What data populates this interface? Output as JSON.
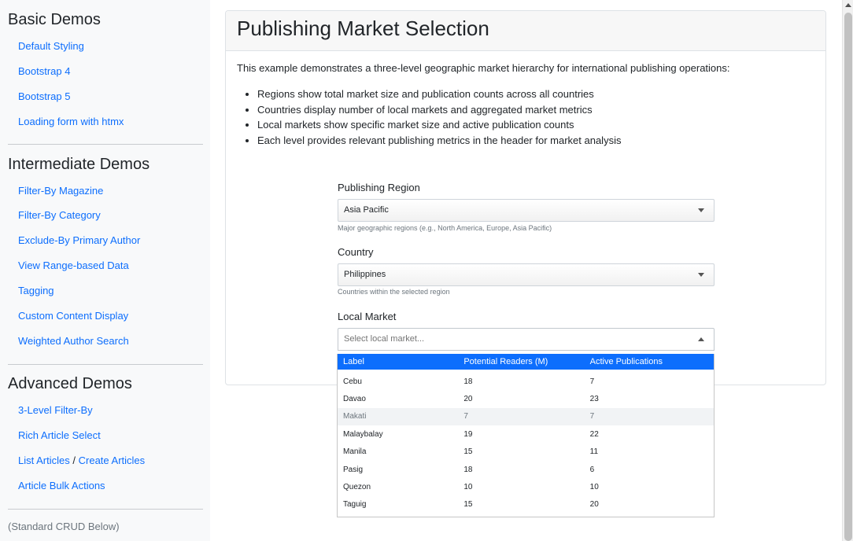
{
  "sidebar": {
    "basic_title": "Basic Demos",
    "basic_items": [
      "Default Styling",
      "Bootstrap 4",
      "Bootstrap 5",
      "Loading form with htmx"
    ],
    "intermediate_title": "Intermediate Demos",
    "intermediate_items": [
      "Filter-By Magazine",
      "Filter-By Category",
      "Exclude-By Primary Author",
      "View Range-based Data",
      "Tagging",
      "Custom Content Display",
      "Weighted Author Search"
    ],
    "advanced_title": "Advanced Demos",
    "advanced_items": [
      "3-Level Filter-By",
      "Rich Article Select"
    ],
    "list_articles": "List Articles",
    "slash": "/",
    "create_articles": "Create Articles",
    "bulk_actions": "Article Bulk Actions",
    "crud_note": "(Standard CRUD Below)"
  },
  "card": {
    "title": "Publishing Market Selection",
    "intro": "This example demonstrates a three-level geographic market hierarchy for international publishing operations:",
    "bullets": [
      "Regions show total market size and publication counts across all countries",
      "Countries display number of local markets and aggregated market metrics",
      "Local markets show specific market size and active publication counts",
      "Each level provides relevant publishing metrics in the header for market analysis"
    ]
  },
  "form": {
    "region_label": "Publishing Region",
    "region_value": "Asia Pacific",
    "region_help": "Major geographic regions (e.g., North America, Europe, Asia Pacific)",
    "country_label": "Country",
    "country_value": "Philippines",
    "country_help": "Countries within the selected region",
    "market_label": "Local Market",
    "market_placeholder": "Select local market..."
  },
  "dropdown": {
    "headers": [
      "Label",
      "Potential Readers (M)",
      "Active Publications"
    ],
    "rows": [
      [
        "Cebu",
        "18",
        "7"
      ],
      [
        "Davao",
        "20",
        "23"
      ],
      [
        "Makati",
        "7",
        "7"
      ],
      [
        "Malaybalay",
        "19",
        "22"
      ],
      [
        "Manila",
        "15",
        "11"
      ],
      [
        "Pasig",
        "18",
        "6"
      ],
      [
        "Quezon",
        "10",
        "10"
      ],
      [
        "Taguig",
        "15",
        "20"
      ]
    ],
    "hovered_index": 2
  },
  "colors": {
    "link": "#0d6efd",
    "header_highlight": "#0d6efd"
  }
}
